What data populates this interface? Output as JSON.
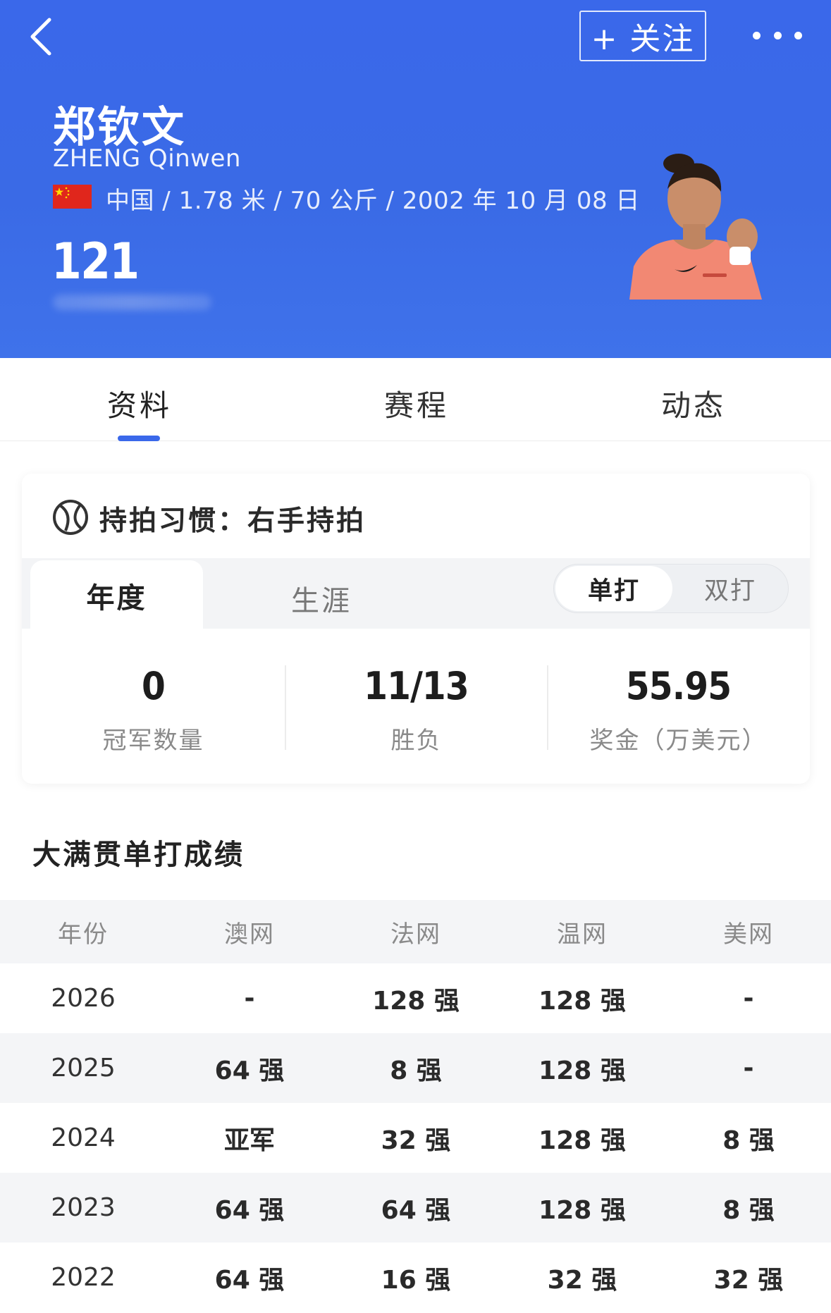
{
  "header": {
    "follow_label": "+ 关注",
    "name_cn": "郑钦文",
    "name_en": "ZHENG Qinwen",
    "info_line": "中国 / 1.78 米 / 70 公斤 / 2002 年 10 月 08 日",
    "rank": "121"
  },
  "tabs": [
    {
      "label": "资料"
    },
    {
      "label": "赛程"
    },
    {
      "label": "动态"
    }
  ],
  "card": {
    "grip": "持拍习惯：右手持拍",
    "period_tabs": [
      "年度",
      "生涯"
    ],
    "type_toggle": [
      "单打",
      "双打"
    ],
    "stats": [
      {
        "value": "0",
        "label": "冠军数量"
      },
      {
        "value": "11/13",
        "label": "胜负"
      },
      {
        "value": "55.95",
        "label": "奖金（万美元）"
      }
    ]
  },
  "grand_slam": {
    "title": "大满贯单打成绩",
    "headers": [
      "年份",
      "澳网",
      "法网",
      "温网",
      "美网"
    ],
    "rows": [
      [
        "2026",
        "-",
        "128 强",
        "128 强",
        "-"
      ],
      [
        "2025",
        "64 强",
        "8 强",
        "128 强",
        "-"
      ],
      [
        "2024",
        "亚军",
        "32 强",
        "128 强",
        "8 强"
      ],
      [
        "2023",
        "64 强",
        "64 强",
        "128 强",
        "8 强"
      ],
      [
        "2022",
        "64 强",
        "16 强",
        "32 强",
        "32 强"
      ]
    ]
  },
  "colors": {
    "header_blue": "#3a68ea",
    "tab_indicator": "#3a68ea"
  }
}
